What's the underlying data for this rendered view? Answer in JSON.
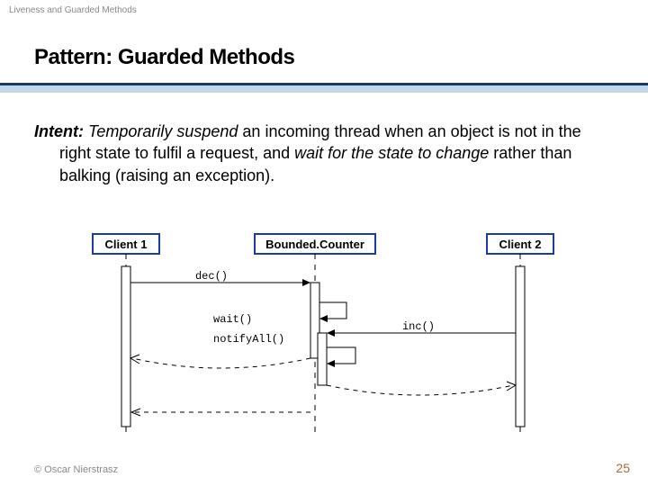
{
  "header": {
    "category": "Liveness and Guarded Methods",
    "title": "Pattern: Guarded Methods"
  },
  "intent": {
    "label": "Intent:",
    "suspend": "Temporarily suspend",
    "part1": " an incoming thread when an object is not in the right state to fulfil a request, and ",
    "wait": "wait for the state to change",
    "part2": " rather than balking (raising an exception)."
  },
  "diagram": {
    "objects": {
      "client1": "Client 1",
      "counter": "Bounded.Counter",
      "client2": "Client 2"
    },
    "messages": {
      "dec": "dec()",
      "wait": "wait()",
      "notifyAll": "notifyAll()",
      "inc": "inc()"
    }
  },
  "footer": {
    "copyright": "© Oscar Nierstrasz",
    "page": "25"
  }
}
